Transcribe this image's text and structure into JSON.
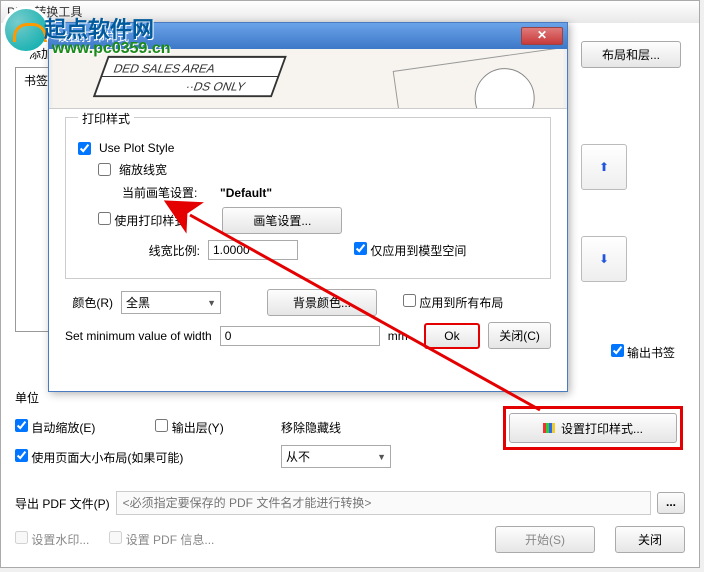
{
  "main": {
    "title": "PDF 转换工具",
    "add_label": "添加",
    "tab_bookmark": "书签",
    "layout_layers_btn": "布局和层...",
    "unit_label": "单位",
    "output_bookmark": "输出书签",
    "auto_scale": "自动缩放(E)",
    "output_layer": "输出层(Y)",
    "remove_hidden": "移除隐藏线",
    "never_option": "从不",
    "use_page_size": "使用页面大小布局(如果可能)",
    "set_print_style_btn": "设置打印样式...",
    "export_label": "导出 PDF 文件(P)",
    "export_placeholder": "<必须指定要保存的 PDF 文件名才能进行转换>",
    "set_watermark": "设置水印...",
    "set_pdf_info": "设置 PDF 信息...",
    "start_btn": "开始(S)",
    "close_btn": "关闭",
    "browse": "..."
  },
  "dialog": {
    "title": "设置打印样式",
    "group_legend": "打印样式",
    "use_plot_style": "Use Plot Style",
    "scale_lineweight": "缩放线宽",
    "current_pen_label": "当前画笔设置:",
    "current_pen_value": "\"Default\"",
    "use_print_style": "使用打印样式",
    "pen_settings_btn": "画笔设置...",
    "lineweight_ratio_label": "线宽比例:",
    "lineweight_ratio_value": "1.0000",
    "apply_model_only": "仅应用到模型空间",
    "color_label": "颜色(R)",
    "color_value": "全黑",
    "bg_color_btn": "背景颜色...",
    "apply_all_layouts": "应用到所有布局",
    "min_width_label": "Set minimum value of width",
    "min_width_value": "0",
    "mm_label": "mm",
    "ok_btn": "Ok",
    "close_btn": "关闭(C)"
  },
  "watermark": {
    "site_name": "起点软件网",
    "site_url": "www.pc0359.cn"
  }
}
